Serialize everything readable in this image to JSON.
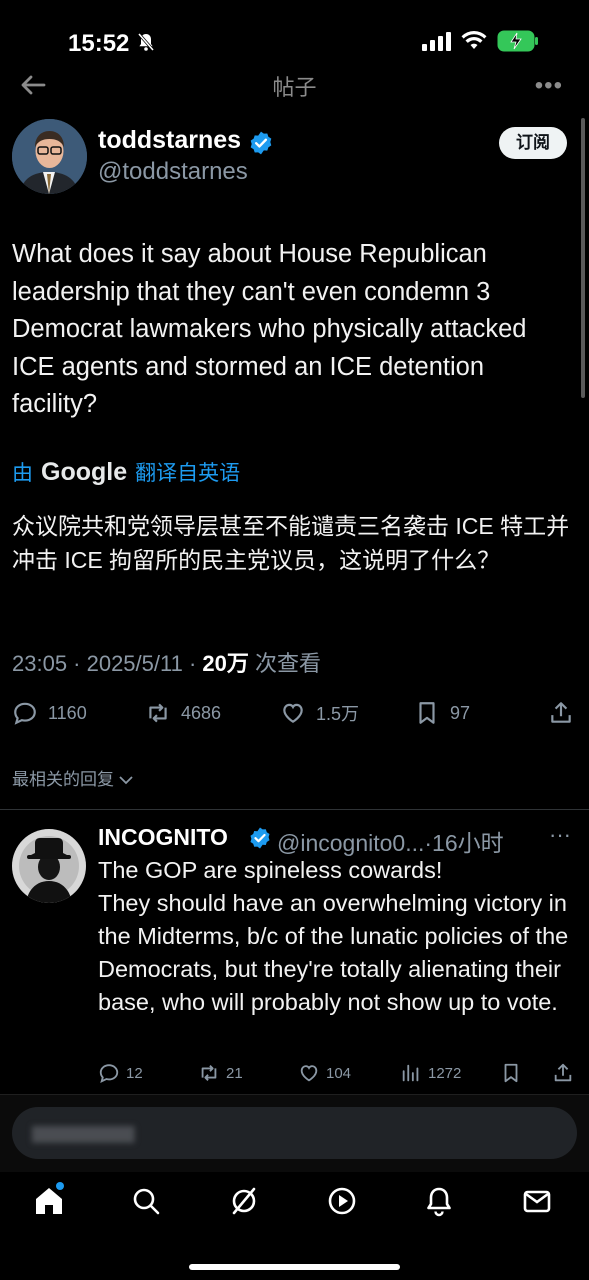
{
  "status_bar": {
    "time": "15:52"
  },
  "nav": {
    "title": "帖子"
  },
  "post": {
    "author_name": "toddstarnes",
    "author_handle": "@toddstarnes",
    "subscribe_label": "订阅",
    "text": "What does it say about House Republican leadership that they can't even condemn 3 Democrat lawmakers who physically attacked ICE agents and stormed an ICE detention facility?",
    "translate_prefix": "由",
    "translate_brand": "Google",
    "translate_suffix": "翻译自英语",
    "translated_text": "众议院共和党领导层甚至不能谴责三名袭击 ICE 特工并冲击 ICE 拘留所的民主党议员，这说明了什么？",
    "timestamp": "23:05 · 2025/5/11 · ",
    "views_count": "20万",
    "views_label": " 次查看",
    "stats": {
      "replies": "1160",
      "reposts": "4686",
      "likes": "1.5万",
      "bookmarks": "97"
    }
  },
  "replies_sort_label": "最相关的回复",
  "reply": {
    "author_name": "INCOGNITO",
    "author_handle": "@incognito0...",
    "time": "·16小时",
    "more": "···",
    "text": "The GOP are spineless cowards!\nThey should have an overwhelming victory in the Midterms, b/c of the lunatic policies of the Democrats, but they're totally alienating their base, who will probably not show up to vote.",
    "stats": {
      "replies": "12",
      "reposts": "21",
      "likes": "104",
      "views": "1272"
    }
  },
  "colors": {
    "accent": "#1d9bf0",
    "background": "#000000",
    "muted": "#8b98a5"
  }
}
